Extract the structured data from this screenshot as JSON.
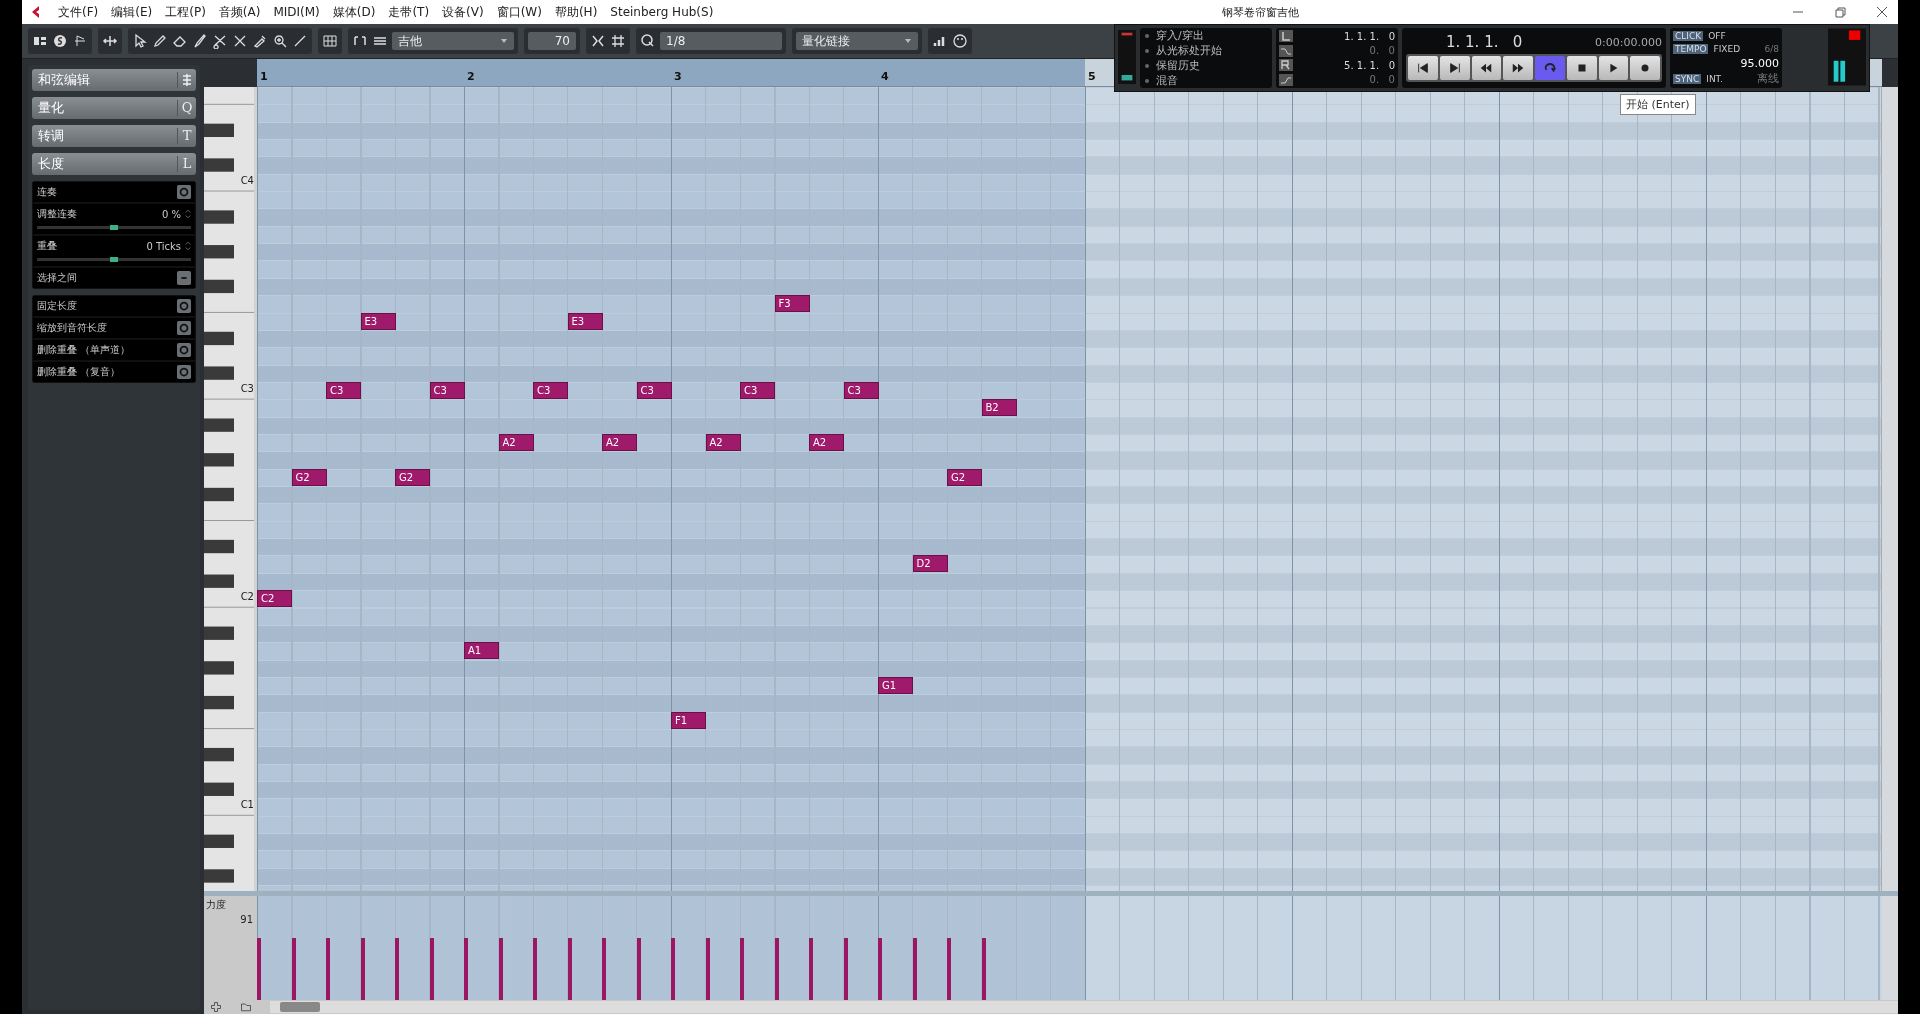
{
  "window": {
    "title": "钢琴卷帘窗吉他"
  },
  "menu": [
    "文件(F)",
    "编辑(E)",
    "工程(P)",
    "音频(A)",
    "MIDI(M)",
    "媒体(D)",
    "走带(T)",
    "设备(V)",
    "窗口(W)",
    "帮助(H)",
    "Steinberg Hub(S)"
  ],
  "toolbar": {
    "track": "吉他",
    "velocity": "70",
    "quantize": "1/8",
    "quantize_link": "量化链接"
  },
  "inspector": {
    "sections": [
      {
        "label": "和弦编辑",
        "kind": "icon"
      },
      {
        "label": "量化",
        "kind": "key",
        "key": "Q"
      },
      {
        "label": "转调",
        "kind": "key",
        "key": "T"
      },
      {
        "label": "长度",
        "kind": "key",
        "key": "L"
      }
    ],
    "length_rows": [
      {
        "label": "连奏",
        "kind": "button"
      },
      {
        "label": "调整连奏",
        "kind": "slider",
        "value": "0 %",
        "level": 0.5
      },
      {
        "label": "重叠",
        "kind": "slider",
        "value": "0 Ticks",
        "level": 0.5
      },
      {
        "label": "选择之间",
        "kind": "menu"
      }
    ],
    "length_actions": [
      "固定长度",
      "缩放到音符长度",
      "删除重叠 （单声道）",
      "删除重叠 （复音）"
    ]
  },
  "ruler": [
    "1",
    "2",
    "3",
    "4",
    "5"
  ],
  "keyboard": {
    "labels": [
      "C4",
      "C3",
      "C2",
      "C1"
    ]
  },
  "notes": [
    {
      "label": "C2",
      "level": 0.6
    },
    {
      "label": "G2",
      "level": 0.6
    },
    {
      "label": "C3",
      "level": 0.6
    },
    {
      "label": "E3",
      "level": 0.6
    },
    {
      "label": "G2",
      "level": 0.6
    },
    {
      "label": "C3",
      "level": 0.6
    },
    {
      "label": "A1",
      "level": 0.6
    },
    {
      "label": "A2",
      "level": 0.6
    },
    {
      "label": "C3",
      "level": 0.6
    },
    {
      "label": "E3",
      "level": 0.6
    },
    {
      "label": "A2",
      "level": 0.6
    },
    {
      "label": "C3",
      "level": 0.6
    },
    {
      "label": "F1",
      "level": 0.6
    },
    {
      "label": "A2",
      "level": 0.6
    },
    {
      "label": "C3",
      "level": 0.6
    },
    {
      "label": "F3",
      "level": 0.6
    },
    {
      "label": "A2",
      "level": 0.6
    },
    {
      "label": "C3",
      "level": 0.6
    },
    {
      "label": "G1",
      "level": 0.6
    },
    {
      "label": "D2",
      "level": 0.6
    },
    {
      "label": "G2",
      "level": 0.6
    },
    {
      "label": "B2",
      "level": 0.6
    }
  ],
  "velocity_lane": {
    "label": "力度",
    "value": "91"
  },
  "transport": {
    "options": [
      "穿入/穿出",
      "从光标处开始",
      "保留历史",
      "混音"
    ],
    "left_locator": "1. 1. 1.   0",
    "left_offset": "0.   0",
    "right_locator": "5. 1. 1.   0",
    "right_offset": "0.   0",
    "position": "1. 1. 1.   0",
    "time": "0:00:00.000",
    "click": {
      "label": "CLICK",
      "value": "OFF"
    },
    "tempo": {
      "label": "TEMPO",
      "value": "FIXED",
      "signature": "6/8",
      "bpm": "95.000"
    },
    "sync": {
      "label": "SYNC",
      "value": "INT.",
      "status": "离线"
    },
    "buttons": [
      {
        "kind": "start",
        "on": false
      },
      {
        "kind": "end",
        "on": false
      },
      {
        "kind": "rewind",
        "on": false
      },
      {
        "kind": "forward",
        "on": false
      },
      {
        "kind": "cycle",
        "on": true
      },
      {
        "kind": "stop",
        "on": false
      },
      {
        "kind": "play",
        "on": false
      },
      {
        "kind": "record",
        "on": false
      }
    ]
  },
  "tooltip": "开始 (Enter)"
}
